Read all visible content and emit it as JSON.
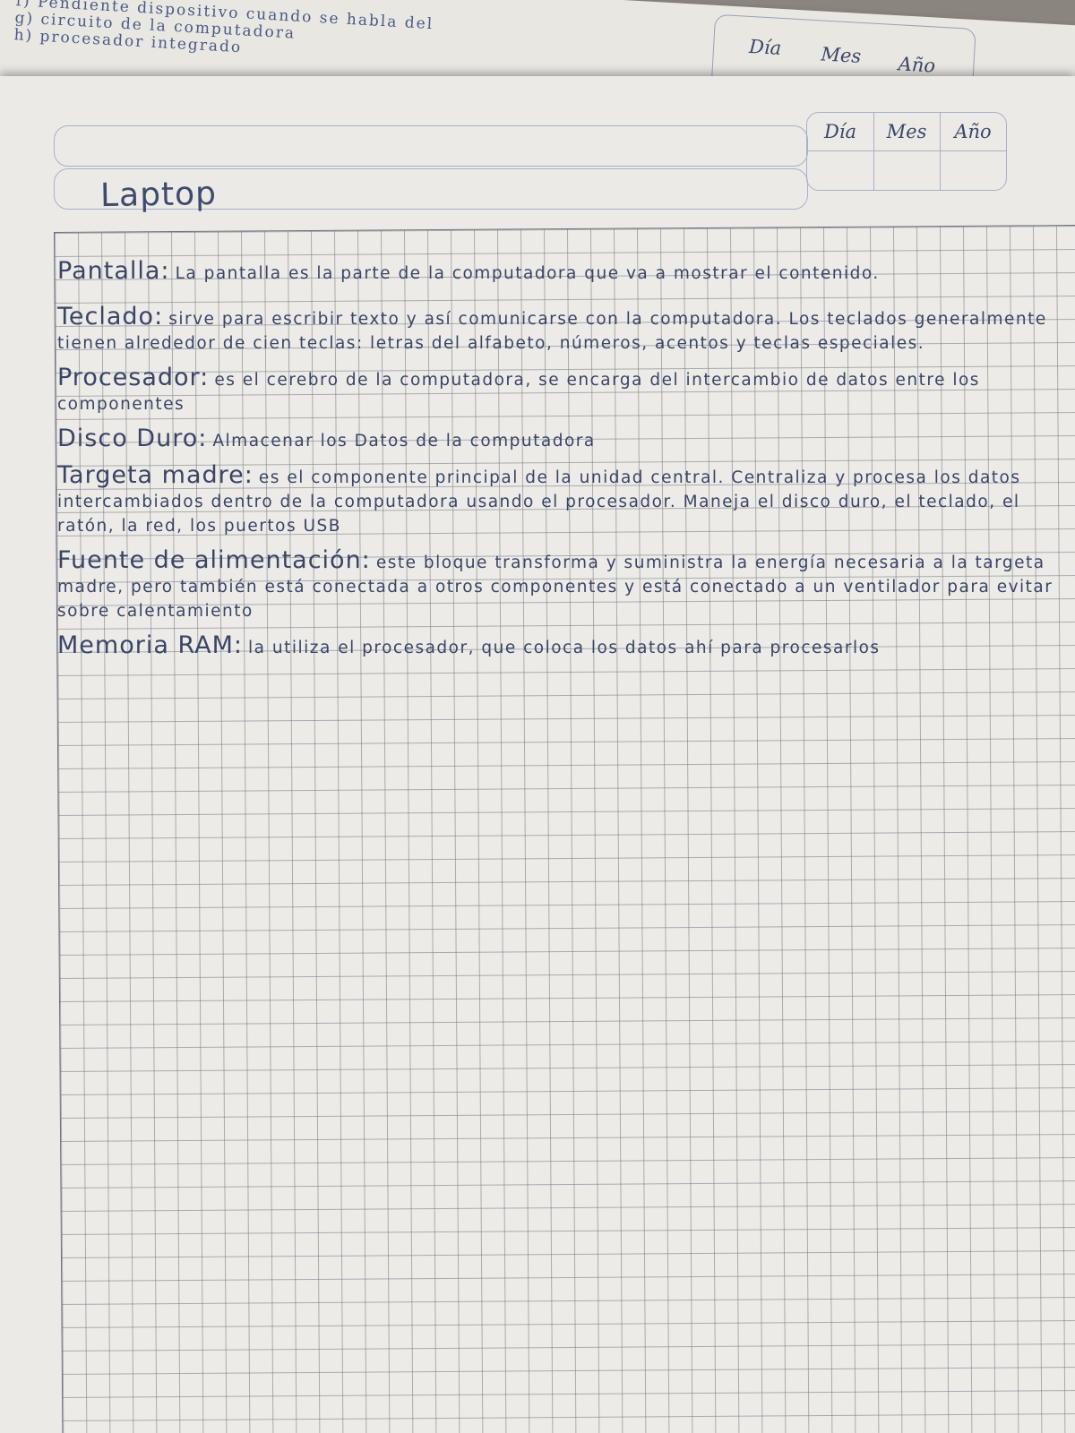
{
  "back_sheet": {
    "lines": [
      "f) Pendiente dispositivo cuando se habla del",
      "g) circuito de la computadora",
      "h) procesador integrado"
    ],
    "date_labels": [
      "Día",
      "Mes",
      "Año"
    ]
  },
  "sheet": {
    "date_labels": [
      "Día",
      "Mes",
      "Año"
    ],
    "title": "Laptop",
    "entries": [
      {
        "term": "Pantalla:",
        "definition": "La pantalla es la parte de la computadora que va a mostrar el contenido."
      },
      {
        "term": "Teclado:",
        "definition": "sirve para escribir texto y así comunicarse con la computadora. Los teclados generalmente tienen alrededor de cien teclas: letras del alfabeto, números, acentos y teclas especiales."
      },
      {
        "term": "Procesador:",
        "definition": "es el cerebro de la computadora, se encarga del intercambio de datos entre los componentes"
      },
      {
        "term": "Disco Duro:",
        "definition": "Almacenar los Datos de la computadora"
      },
      {
        "term": "Targeta madre:",
        "definition": "es el componente principal de la unidad central. Centraliza y procesa los datos intercambiados dentro de la computadora usando el procesador. Maneja el disco duro, el teclado, el ratón, la red, los puertos USB"
      },
      {
        "term": "Fuente de alimentación:",
        "definition": "este bloque transforma y suministra la energía necesaria a la targeta madre, pero también está conectada a otros componentes y está conectado a un ventilador para evitar sobre calentamiento"
      },
      {
        "term": "Memoria RAM:",
        "definition": "la utiliza el procesador, que coloca los datos ahí para procesarlos"
      }
    ]
  }
}
